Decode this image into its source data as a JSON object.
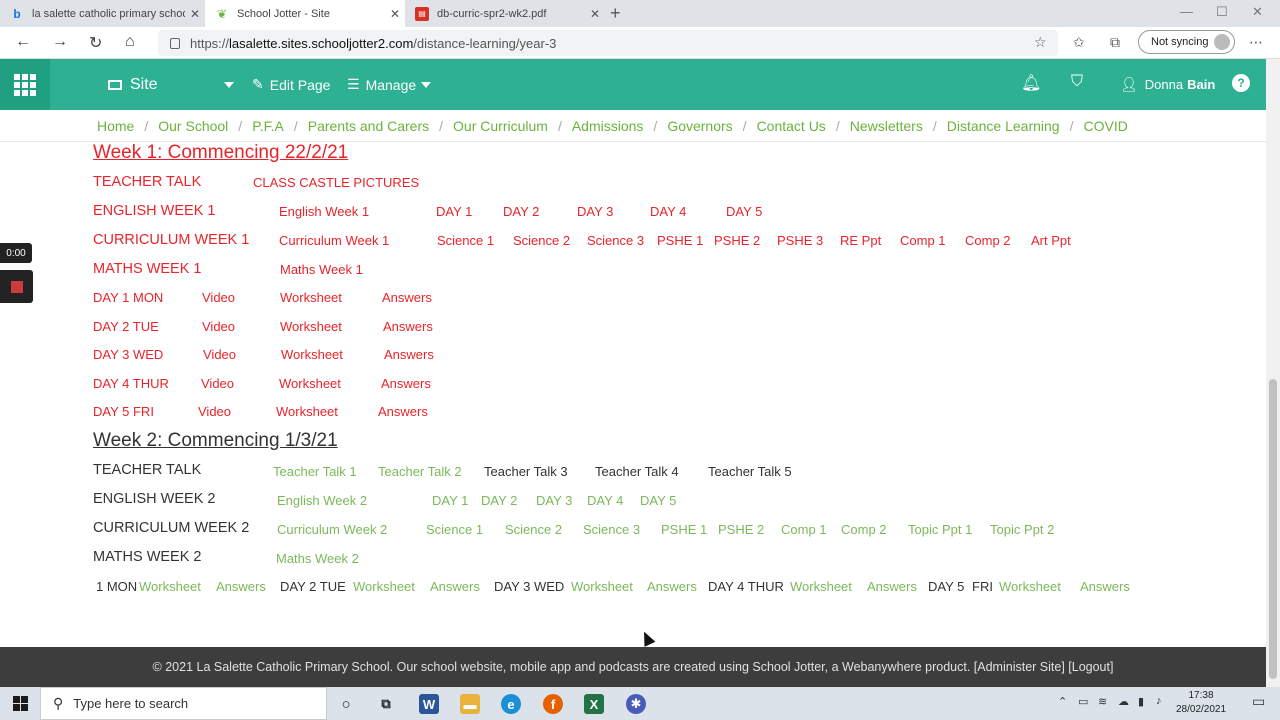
{
  "browser": {
    "tabs": [
      {
        "label": "la salette catholic primary school",
        "favicon": "bing-icon"
      },
      {
        "label": "School Jotter - Site",
        "favicon": "leaf-icon"
      },
      {
        "label": "db-curric-spr2-wk2.pdf",
        "favicon": "pdf-icon"
      }
    ],
    "url_prefix": "https://",
    "url_host": "lasalette.sites.schooljotter2.com",
    "url_path": "/distance-learning/year-3",
    "sync_label": "Not syncing"
  },
  "sitebar": {
    "site_label": "Site",
    "edit_label": "Edit Page",
    "manage_label": "Manage",
    "user_first": "Donna",
    "user_last": "Bain"
  },
  "menu": [
    "Home",
    "Our School",
    "P.F.A",
    "Parents and Carers",
    "Our Curriculum",
    "Admissions",
    "Governors",
    "Contact Us",
    "Newsletters",
    "Distance Learning",
    "COVID"
  ],
  "week1": {
    "heading": "Week 1: Commencing 22/2/21",
    "teacher_talk": "TEACHER TALK",
    "castle": "CLASS CASTLE PICTURES",
    "english_head": "ENGLISH WEEK 1",
    "english_link": "English Week 1",
    "days": [
      "DAY 1",
      "DAY 2",
      "DAY 3",
      "DAY 4",
      "DAY 5"
    ],
    "curriculum_head": "CURRICULUM WEEK 1",
    "curriculum_link": "Curriculum Week 1",
    "curriculum_items": [
      "Science 1",
      "Science 2",
      "Science 3",
      "PSHE 1",
      "PSHE 2",
      "PSHE 3",
      "RE Ppt",
      "Comp 1",
      "Comp 2",
      "Art Ppt"
    ],
    "maths_head": "MATHS WEEK 1",
    "maths_link": "Maths Week 1",
    "maths_days": [
      {
        "day": "DAY 1  MON",
        "video": "Video",
        "worksheet": "Worksheet",
        "answers": "Answers"
      },
      {
        "day": "DAY 2  TUE",
        "video": "Video",
        "worksheet": "Worksheet",
        "answers": "Answers"
      },
      {
        "day": "DAY 3  WED",
        "video": "Video",
        "worksheet": "Worksheet",
        "answers": "Answers"
      },
      {
        "day": "DAY 4  THUR",
        "video": "Video",
        "worksheet": "Worksheet",
        "answers": "Answers"
      },
      {
        "day": "DAY 5  FRI",
        "video": "Video",
        "worksheet": "Worksheet",
        "answers": "Answers"
      }
    ]
  },
  "week2": {
    "heading": "Week 2: Commencing 1/3/21",
    "teacher_talk": "TEACHER TALK",
    "talks": [
      "Teacher Talk 1",
      "Teacher Talk 2",
      "Teacher Talk 3",
      "Teacher Talk 4",
      "Teacher Talk 5"
    ],
    "english_head": "ENGLISH WEEK 2",
    "english_link": "English Week 2",
    "days": [
      "DAY 1",
      "DAY 2",
      "DAY 3",
      "DAY 4",
      "DAY 5"
    ],
    "curriculum_head": "CURRICULUM WEEK 2",
    "curriculum_link": "Curriculum Week 2",
    "curriculum_items": [
      "Science 1",
      "Science 2",
      "Science 3",
      "PSHE 1",
      "PSHE 2",
      "Comp 1",
      "Comp 2",
      "Topic Ppt 1",
      "Topic Ppt 2"
    ],
    "maths_head": "MATHS WEEK 2",
    "maths_link": "Maths Week 2",
    "maths_row": {
      "d1": "1 MON",
      "d2": "DAY 2 TUE",
      "d3": "DAY 3 WED",
      "d4": "DAY 4 THUR",
      "d5": "DAY 5",
      "d5b": "FRI",
      "worksheet": "Worksheet",
      "answers": "Answers"
    }
  },
  "footer": "© 2021 La Salette Catholic Primary School. Our school website, mobile app and podcasts are created using School Jotter, a Webanywhere product. [Administer Site] [Logout]",
  "recorder": {
    "timer": "0:00"
  },
  "taskbar": {
    "search_placeholder": "Type here to search",
    "time": "17:38",
    "date": "28/02/2021"
  }
}
